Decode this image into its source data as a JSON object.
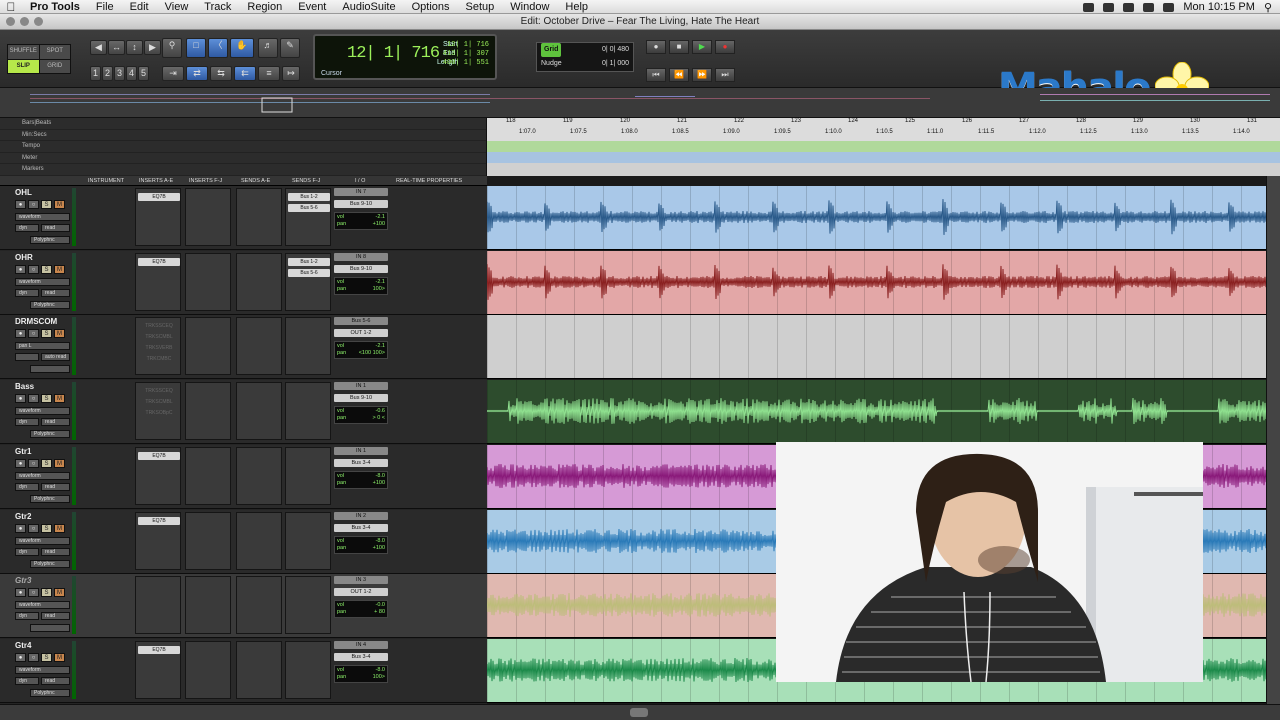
{
  "menubar": {
    "app": "Pro Tools",
    "items": [
      "File",
      "Edit",
      "View",
      "Track",
      "Region",
      "Event",
      "AudioSuite",
      "Options",
      "Setup",
      "Window",
      "Help"
    ],
    "clock": "Mon 10:15 PM"
  },
  "window": {
    "title": "Edit: October Drive – Fear The Living, Hate The Heart"
  },
  "toolbar": {
    "modes": [
      "SHUFFLE",
      "SPOT",
      "SLIP",
      "GRID"
    ],
    "zoom_presets": [
      "1",
      "2",
      "3",
      "4",
      "5"
    ],
    "counter": {
      "main": "12| 1| 716",
      "cursor_label": "Cursor",
      "start_label": "Start",
      "start": "12| 1| 716",
      "end_label": "End",
      "end": "413| 1| 307",
      "length_label": "Length",
      "length": "400| 1| 551"
    },
    "grid": {
      "label": "Grid",
      "value": "0| 0| 480"
    },
    "nudge": {
      "label": "Nudge",
      "value": "0| 1| 000"
    }
  },
  "logo": {
    "text": "Mahalo"
  },
  "rulers": {
    "labels": [
      "Bars|Beats",
      "Min:Secs",
      "Tempo",
      "Meter",
      "Markers"
    ],
    "bars": [
      "118",
      "119",
      "120",
      "121",
      "122",
      "123",
      "124",
      "125",
      "126",
      "127",
      "128",
      "129",
      "130",
      "131"
    ],
    "times": [
      "1:07.0",
      "1:07.5",
      "1:08.0",
      "1:08.5",
      "1:09.0",
      "1:09.5",
      "1:10.0",
      "1:10.5",
      "1:11.0",
      "1:11.5",
      "1:12.0",
      "1:12.5",
      "1:13.0",
      "1:13.5",
      "1:14.0"
    ]
  },
  "columns": [
    "INSTRUMENT",
    "INSERTS A-E",
    "INSERTS F-J",
    "SENDS A-E",
    "SENDS F-J",
    "I / O",
    "REAL-TIME PROPERTIES"
  ],
  "tracks": [
    {
      "name": "OHL",
      "view": "waveform",
      "auto": "dyn",
      "automode": "read",
      "timebase": "Polyphnc",
      "inserts": [
        "EQ7B"
      ],
      "sends": [
        "Bus 1-2",
        "Bus 5-6"
      ],
      "input": "IN 7",
      "output": "Bus 9-10",
      "vol": "-2.1",
      "pan": "+100",
      "color": "#a9c8e8",
      "wave": "#2a5a8a",
      "dim": false
    },
    {
      "name": "OHR",
      "view": "waveform",
      "auto": "dyn",
      "automode": "read",
      "timebase": "Polyphnc",
      "inserts": [
        "EQ7B"
      ],
      "sends": [
        "Bus 1-2",
        "Bus 5-6"
      ],
      "input": "IN 8",
      "output": "Bus 9-10",
      "vol": "-2.1",
      "pan": "100>",
      "color": "#e3a7a7",
      "wave": "#8a2020",
      "dim": false
    },
    {
      "name": "DRMSCOM",
      "view": "pan L",
      "auto": "",
      "automode": "auto read",
      "timebase": "",
      "inserts": [
        "TRKSSCEQ",
        "TRKSCMBL",
        "TRKSVERB",
        "TRKCMBC"
      ],
      "sends": [],
      "input": "Bus 5-6",
      "output": "OUT 1-2",
      "vol": "-2.1",
      "pan": "<100   100>",
      "color": "#cfcfcf",
      "wave": "#cfcfcf",
      "dim": false
    },
    {
      "name": "Bass",
      "view": "waveform",
      "auto": "dyn",
      "automode": "read",
      "timebase": "Polyphnc",
      "inserts": [
        "TRKSSCEQ",
        "TRKSCMBL",
        "TRKSOBpC"
      ],
      "sends": [],
      "input": "IN 1",
      "output": "Bus 9-10",
      "vol": "-0.6",
      "pan": "> 0 <",
      "color": "#2d4c2d",
      "wave": "#8fe08f",
      "dim": false
    },
    {
      "name": "Gtr1",
      "view": "waveform",
      "auto": "dyn",
      "automode": "read",
      "timebase": "Polyphnc",
      "inserts": [
        "EQ7B"
      ],
      "sends": [],
      "input": "IN 1",
      "output": "Bus 3-4",
      "vol": "-8.0",
      "pan": "+100",
      "color": "#d69ad6",
      "wave": "#8a1a7a",
      "dim": false
    },
    {
      "name": "Gtr2",
      "view": "waveform",
      "auto": "dyn",
      "automode": "read",
      "timebase": "Polyphnc",
      "inserts": [
        "EQ7B"
      ],
      "sends": [],
      "input": "IN 2",
      "output": "Bus 3-4",
      "vol": "-8.0",
      "pan": "+100",
      "color": "#a9cbe6",
      "wave": "#2a7ab8",
      "dim": false
    },
    {
      "name": "Gtr3",
      "view": "waveform",
      "auto": "dyn",
      "automode": "read",
      "timebase": "",
      "inserts": [],
      "sends": [],
      "input": "IN 3",
      "output": "OUT 1-2",
      "vol": "-0.0",
      "pan": "+ 80",
      "color": "#e0b8b0",
      "wave": "#bdbd7a",
      "dim": true
    },
    {
      "name": "Gtr4",
      "view": "waveform",
      "auto": "dyn",
      "automode": "read",
      "timebase": "Polyphnc",
      "inserts": [
        "EQ7B"
      ],
      "sends": [],
      "input": "IN 4",
      "output": "Bus 3-4",
      "vol": "-8.0",
      "pan": "100>",
      "color": "#a8e0b8",
      "wave": "#1c8a4a",
      "dim": false
    }
  ],
  "labels": {
    "vol": "vol",
    "pan": "pan",
    "solo": "S",
    "mute": "M"
  }
}
